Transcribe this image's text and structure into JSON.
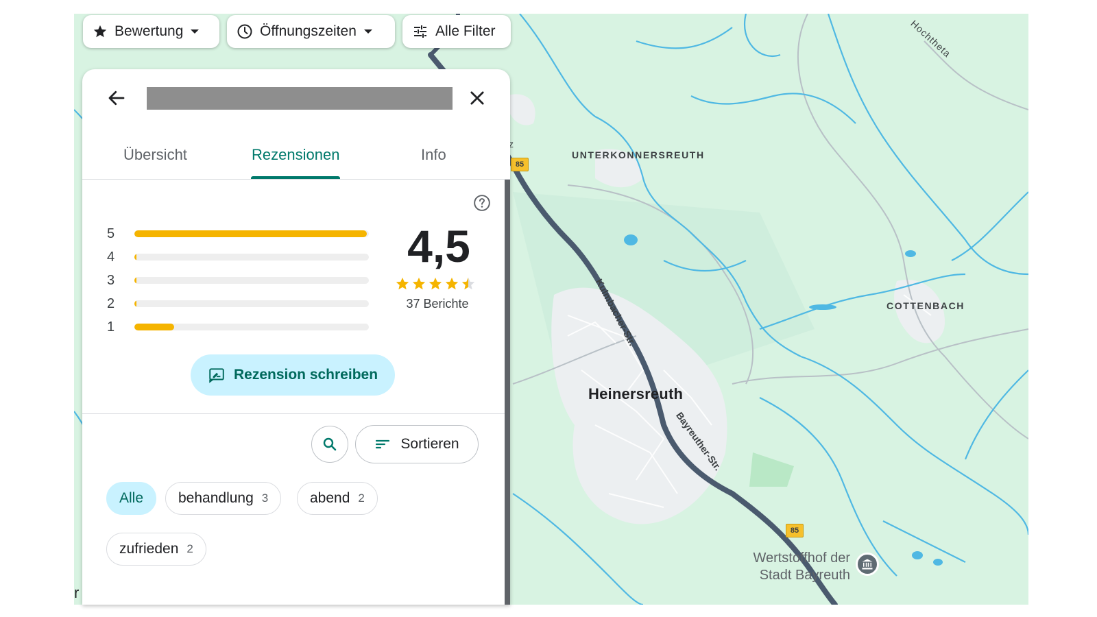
{
  "filters": {
    "rating_label": "Bewertung",
    "hours_label": "Öffnungszeiten",
    "all_filters_label": "Alle Filter"
  },
  "panel": {
    "tabs": [
      {
        "label": "Übersicht",
        "active": false
      },
      {
        "label": "Rezensionen",
        "active": true
      },
      {
        "label": "Info",
        "active": false
      }
    ],
    "histogram": [
      {
        "stars": "5",
        "fraction": 0.99
      },
      {
        "stars": "4",
        "fraction": 0.01
      },
      {
        "stars": "3",
        "fraction": 0.01
      },
      {
        "stars": "2",
        "fraction": 0.01
      },
      {
        "stars": "1",
        "fraction": 0.17
      }
    ],
    "rating": "4,5",
    "stars_value": 4.5,
    "review_count": "37 Berichte",
    "write_review_label": "Rezension schreiben",
    "sort_label": "Sortieren",
    "topics": [
      {
        "label": "Alle",
        "count": "",
        "active": true
      },
      {
        "label": "behandlung",
        "count": "3",
        "active": false
      },
      {
        "label": "abend",
        "count": "2",
        "active": false
      },
      {
        "label": "zufrieden",
        "count": "2",
        "active": false
      }
    ]
  },
  "map": {
    "labels": {
      "unterkonnersreuth": "UNTERKONNERSREUTH",
      "cottenbach": "COTTENBACH",
      "hochtheta": "Hochtheta",
      "town": "Heinersreuth",
      "street_kulmbacher": "Kulmbacher-Str.",
      "street_bayreuther": "Bayreuther-Str.",
      "route_85_top": "85",
      "route_85_bottom": "85",
      "poi_line1": "Wertstoffhof der",
      "poi_line2": "Stadt Bayreuth",
      "edge_letter_z": "z",
      "edge_letter_r": "r"
    },
    "colors": {
      "land": "#d8f3e2",
      "water": "#4fb8e3",
      "highway": "#4a5a6e",
      "road": "#c7ccd1",
      "settlement": "#eceff1",
      "park": "#b9e8c6",
      "accent": "#00796b",
      "star": "#f5b400"
    }
  }
}
